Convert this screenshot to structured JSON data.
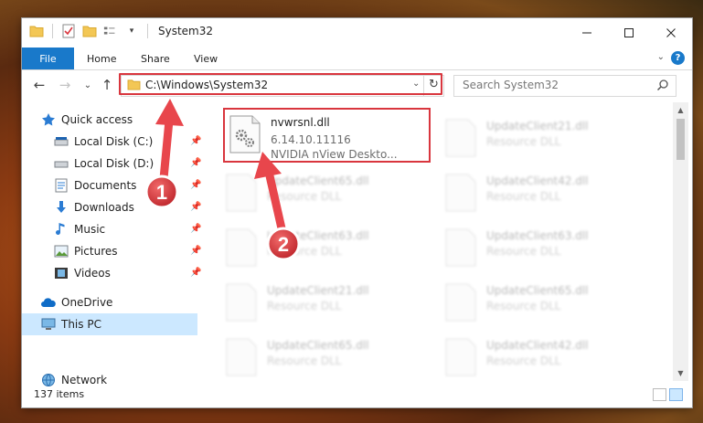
{
  "window": {
    "title": "System32",
    "caption": {
      "minimize": "—",
      "maximize": "☐",
      "close": "✕"
    }
  },
  "ribbon": {
    "tabs": [
      "File",
      "Home",
      "Share",
      "View"
    ],
    "help": "?"
  },
  "nav": {
    "back": "←",
    "forward": "→",
    "recent": "⌄",
    "up": "↑",
    "address": "C:\\Windows\\System32",
    "search_placeholder": "Search System32"
  },
  "sidebar": {
    "items": [
      {
        "label": "Quick access",
        "icon": "star-icon",
        "pinned": false
      },
      {
        "label": "Local Disk (C:)",
        "icon": "drive-icon",
        "pinned": true
      },
      {
        "label": "Local Disk (D:)",
        "icon": "drive-icon",
        "pinned": true
      },
      {
        "label": "Documents",
        "icon": "documents-icon",
        "pinned": true
      },
      {
        "label": "Downloads",
        "icon": "download-icon",
        "pinned": true
      },
      {
        "label": "Music",
        "icon": "music-icon",
        "pinned": true
      },
      {
        "label": "Pictures",
        "icon": "pictures-icon",
        "pinned": true
      },
      {
        "label": "Videos",
        "icon": "videos-icon",
        "pinned": true
      },
      {
        "label": "OneDrive",
        "icon": "cloud-icon",
        "pinned": false
      },
      {
        "label": "This PC",
        "icon": "computer-icon",
        "pinned": false,
        "selected": true
      },
      {
        "label": "Network",
        "icon": "network-icon",
        "pinned": false
      }
    ]
  },
  "files": {
    "highlighted": {
      "name": "nvwrsnl.dll",
      "version": "6.14.10.11116",
      "description": "NVIDIA nView Deskto..."
    },
    "faded": [
      {
        "name": "UpdateClient21.dll",
        "type": "Resource DLL"
      },
      {
        "name": "UpdateClient65.dll",
        "type": "Resource DLL"
      },
      {
        "name": "UpdateClient42.dll",
        "type": "Resource DLL"
      },
      {
        "name": "UpdateClient63.dll",
        "type": "Resource DLL"
      },
      {
        "name": "UpdateClient63.dll",
        "type": "Resource DLL"
      },
      {
        "name": "UpdateClient21.dll",
        "type": "Resource DLL"
      },
      {
        "name": "UpdateClient65.dll",
        "type": "Resource DLL"
      },
      {
        "name": "UpdateClient65.dll",
        "type": "Resource DLL"
      },
      {
        "name": "UpdateClient42.dll",
        "type": "Resource DLL"
      }
    ]
  },
  "status": {
    "item_count": "137 items"
  },
  "annotations": {
    "step1": "1",
    "step2": "2"
  },
  "colors": {
    "accent": "#1979ca",
    "highlight": "#d9363e",
    "selected_bg": "#cce8ff"
  }
}
